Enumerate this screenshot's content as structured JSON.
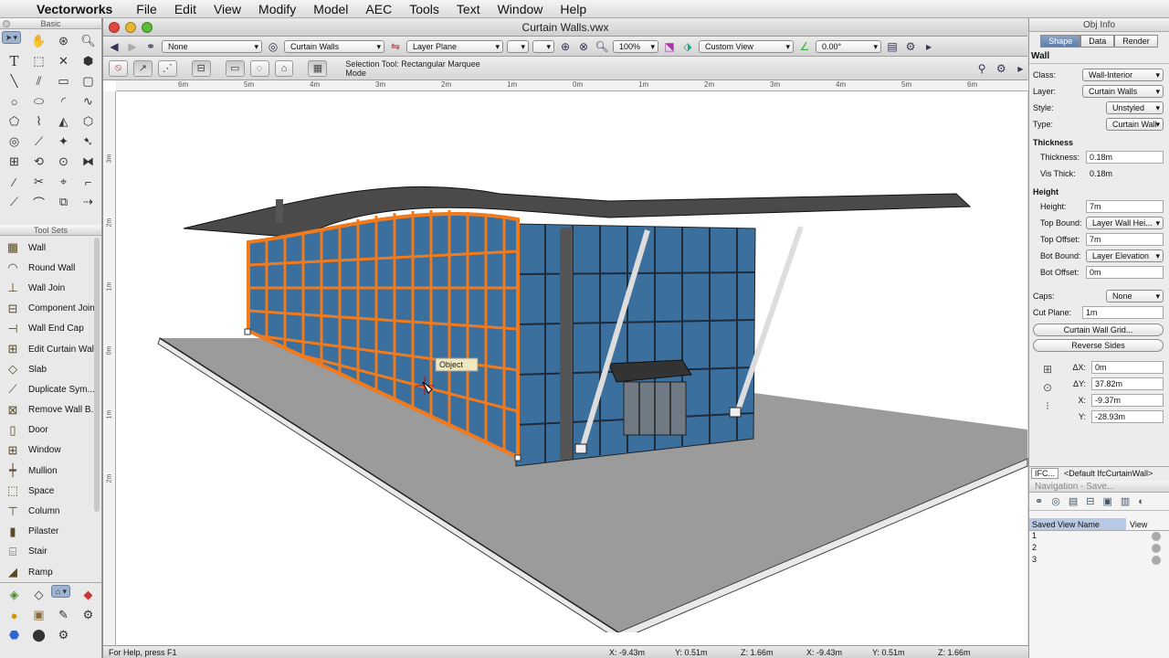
{
  "menubar": {
    "app": "Vectorworks",
    "items": [
      "File",
      "Edit",
      "View",
      "Modify",
      "Model",
      "AEC",
      "Tools",
      "Text",
      "Window",
      "Help"
    ]
  },
  "basic_palette": {
    "title": "Basic"
  },
  "toolsets": {
    "title": "Tool Sets",
    "items": [
      "Wall",
      "Round Wall",
      "Wall Join",
      "Component Join",
      "Wall End Cap",
      "Edit Curtain Wall",
      "Slab",
      "Duplicate Sym...",
      "Remove Wall B...",
      "Door",
      "Window",
      "Mullion",
      "Space",
      "Column",
      "Pilaster",
      "Stair",
      "Ramp"
    ]
  },
  "document": {
    "title": "Curtain Walls.vwx",
    "class_value": "None",
    "layer_value": "Curtain Walls",
    "layer_plane": "Layer Plane",
    "zoom": "100%",
    "view": "Custom View",
    "angle": "0.00°",
    "mode_text": "Selection Tool: Rectangular Marquee Mode",
    "tooltip": "Object",
    "ruler_top": [
      "6m",
      "5m",
      "4m",
      "3m",
      "2m",
      "1m",
      "0m",
      "1m",
      "2m",
      "3m",
      "4m",
      "5m",
      "6m"
    ],
    "ruler_left": [
      "3m",
      "2m",
      "1m",
      "0m",
      "1m",
      "2m"
    ],
    "status_help": "For Help, press F1",
    "status_coords": [
      "X: -9.43m",
      "Y: 0.51m",
      "Z: 1.66m",
      "X: -9.43m",
      "Y: 0.51m",
      "Z: 1.66m"
    ]
  },
  "objinfo": {
    "title": "Obj Info",
    "tabs": [
      "Shape",
      "Data",
      "Render"
    ],
    "object_type": "Wall",
    "class_label": "Class:",
    "class_value": "Wall-Interior",
    "layer_label": "Layer:",
    "layer_value": "Curtain Walls",
    "style_label": "Style:",
    "style_value": "Unstyled",
    "type_label": "Type:",
    "type_value": "Curtain Wall",
    "thickness_section": "Thickness",
    "thickness_label": "Thickness:",
    "thickness_value": "0.18m",
    "visthick_label": "Vis Thick:",
    "visthick_value": "0.18m",
    "height_section": "Height",
    "height_label": "Height:",
    "height_value": "7m",
    "topbound_label": "Top Bound:",
    "topbound_value": "Layer Wall Hei...",
    "topoffset_label": "Top Offset:",
    "topoffset_value": "7m",
    "botbound_label": "Bot Bound:",
    "botbound_value": "Layer Elevation",
    "botoffset_label": "Bot Offset:",
    "botoffset_value": "0m",
    "caps_label": "Caps:",
    "caps_value": "None",
    "cutplane_label": "Cut Plane:",
    "cutplane_value": "1m",
    "grid_button": "Curtain Wall Grid...",
    "reverse_button": "Reverse Sides",
    "dx_label": "ΔX:",
    "dx_value": "0m",
    "dy_label": "ΔY:",
    "dy_value": "37.82m",
    "x_label": "X:",
    "x_value": "-9.37m",
    "y_label": "Y:",
    "y_value": "-28.93m",
    "ifc_label": "IFC...",
    "ifc_value": "<Default IfcCurtainWall>"
  },
  "navigation": {
    "title": "Navigation - Save...",
    "col1": "Saved View Name",
    "col2": "View",
    "rows": [
      "1",
      "2",
      "3"
    ]
  },
  "colors": {
    "selection_orange": "#f07a1c",
    "glass_blue": "#3a6f9e",
    "ground_gray": "#9b9b9b"
  }
}
